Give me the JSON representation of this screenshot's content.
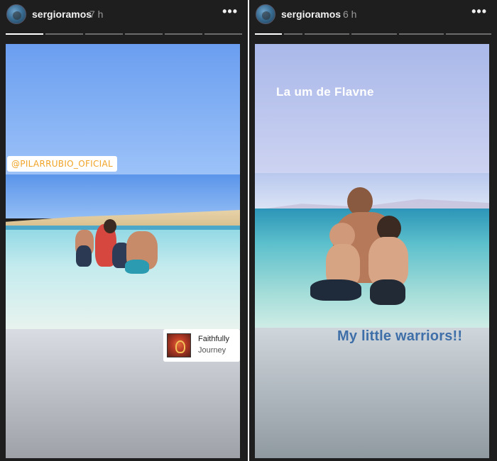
{
  "left_story": {
    "username": "sergioramos",
    "time": "7 h",
    "more_label": "•••",
    "progress": {
      "segments": 6,
      "active_index": 0
    },
    "mention": "@PILARRUBIO_OFICIAL",
    "music": {
      "song": "Faithfully",
      "artist": "Journey"
    }
  },
  "right_story": {
    "username": "sergioramos",
    "time": "6 h",
    "more_label": "•••",
    "progress": {
      "segments": 6,
      "active_index": 0
    },
    "caption_top": "La um de Flavne",
    "caption_bottom": "My little warriors!!"
  },
  "colors": {
    "mention_text": "#f0a325",
    "caption_bottom": "#3f6fa8",
    "header_bg": "#1e1e1e"
  }
}
